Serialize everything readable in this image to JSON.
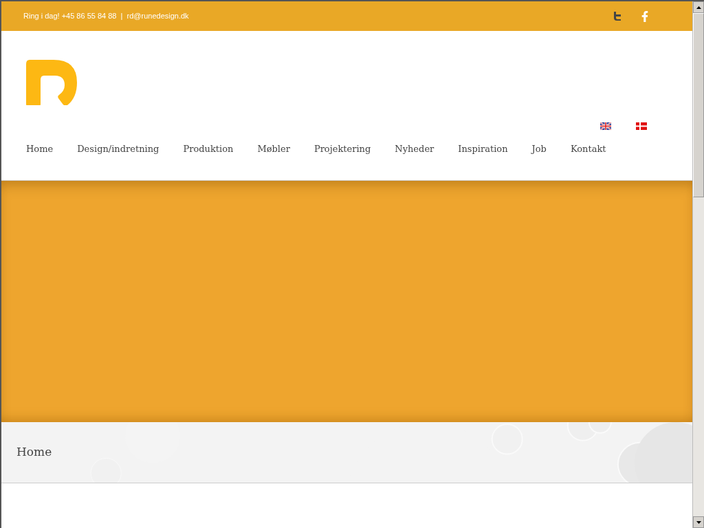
{
  "top_bar": {
    "contact": "Ring i dag! +45 86 55 84 88  |  rd@runedesign.dk"
  },
  "languages": [
    {
      "kind": "uk"
    },
    {
      "kind": "dk"
    }
  ],
  "nav": [
    {
      "label": "Home"
    },
    {
      "label": "Design/indretning"
    },
    {
      "label": "Produktion"
    },
    {
      "label": "Møbler"
    },
    {
      "label": "Projektering"
    },
    {
      "label": "Nyheder"
    },
    {
      "label": "Inspiration"
    },
    {
      "label": "Job"
    },
    {
      "label": "Kontakt"
    }
  ],
  "page_title": "Home"
}
